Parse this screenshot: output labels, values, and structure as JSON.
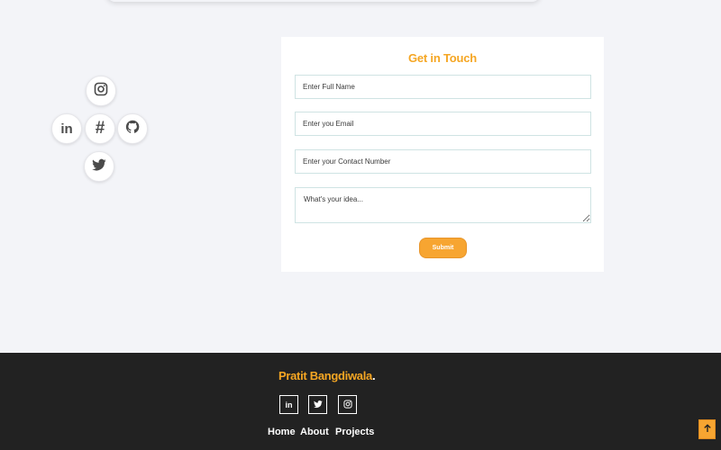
{
  "contact": {
    "title": "Get in Touch",
    "fields": {
      "name_placeholder": "Enter Full Name",
      "email_placeholder": "Enter you Email",
      "phone_placeholder": "Enter your Contact Number",
      "idea_placeholder": "What's your idea..."
    },
    "submit_label": "Submit"
  },
  "social": {
    "icons": [
      "instagram-icon",
      "linkedin-icon",
      "hashnode-icon",
      "github-icon",
      "twitter-icon"
    ],
    "linkedin_glyph": "in",
    "hashnode_glyph": "#"
  },
  "footer": {
    "brand_name": "Pratit Bangdiwala",
    "brand_dot": ".",
    "social_icons": [
      "linkedin-icon",
      "twitter-icon",
      "instagram-icon"
    ],
    "linkedin_glyph": "in",
    "nav": [
      "Home",
      "About",
      "Projects"
    ]
  },
  "colors": {
    "accent": "#f5a623",
    "background": "#f3f4f8",
    "footer_bg": "#222222",
    "card_bg": "#ffffff"
  }
}
